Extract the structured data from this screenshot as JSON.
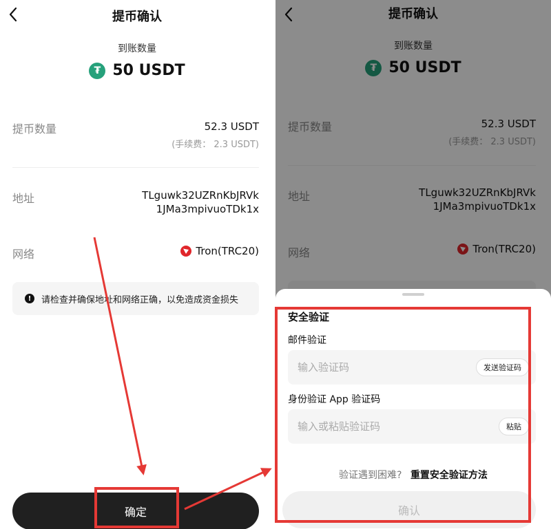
{
  "page": {
    "title": "提币确认",
    "received_label": "到账数量",
    "received_amount": "50 USDT",
    "coin_glyph": "₮",
    "amount_label": "提币数量",
    "amount_value": "52.3 USDT",
    "fee_text": "(手续费： 2.3 USDT)",
    "address_label": "地址",
    "address_value": "TLguwk32UZRnKbJRVk1JMa3mpivuoTDk1x",
    "network_label": "网络",
    "network_value": "Tron(TRC20)",
    "warning_text": "请检查并确保地址和网络正确，以免造成资金损失",
    "info_glyph": "!",
    "confirm_label": "确定"
  },
  "sheet": {
    "title": "安全验证",
    "email_label": "邮件验证",
    "email_placeholder": "输入验证码",
    "send_code_label": "发送验证码",
    "auth_label": "身份验证 App 验证码",
    "auth_placeholder": "输入或粘贴验证码",
    "paste_label": "粘贴",
    "help_question": "验证遇到困难?",
    "help_link": "重置安全验证方法",
    "confirm_label": "确认"
  },
  "colors": {
    "usdt_green": "#26a17b",
    "tron_red": "#e0262b",
    "annotation_red": "#e53935",
    "button_dark": "#202020"
  },
  "icons": [
    "back-arrow-icon",
    "usdt-icon",
    "tron-icon",
    "info-icon"
  ]
}
